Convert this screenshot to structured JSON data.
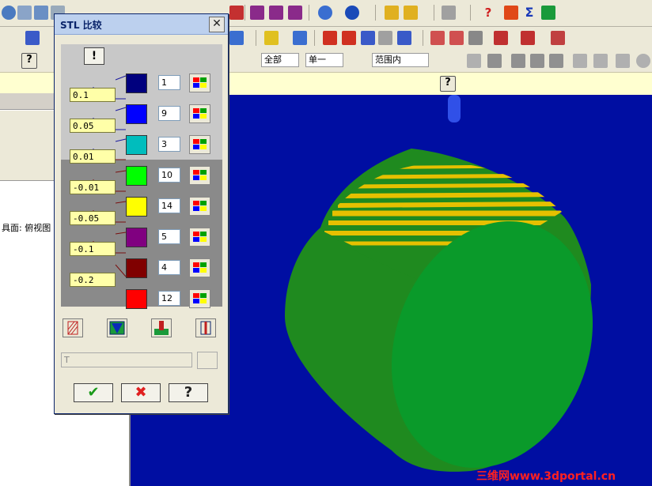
{
  "dialog": {
    "title": "STL 比较",
    "close_label": "✕",
    "help_label": "!",
    "tolerances": [
      "0.1",
      "0.05",
      "0.01",
      "-0.01",
      "-0.05",
      "-0.1",
      "-0.2"
    ],
    "colors": [
      {
        "hex": "#00007e",
        "count": "1"
      },
      {
        "hex": "#0000ff",
        "count": "9"
      },
      {
        "hex": "#00bdbd",
        "count": "3"
      },
      {
        "hex": "#00ff00",
        "count": "10"
      },
      {
        "hex": "#ffff00",
        "count": "14"
      },
      {
        "hex": "#800080",
        "count": "5"
      },
      {
        "hex": "#800000",
        "count": "4"
      },
      {
        "hex": "#ff0000",
        "count": "12"
      }
    ],
    "text_field_value": "T",
    "ok_label": "✔",
    "cancel_label": "✖",
    "help_button_label": "?"
  },
  "toolbar3": {
    "combo_all": "全部",
    "combo_single": "单一",
    "combo_range": "范围内"
  },
  "left_panel": {
    "text": "具面: 俯视图"
  },
  "watermark": "三维网www.3dportal.cn",
  "icons": [
    "help-icon",
    "close-icon",
    "palette-icon",
    "ok-check-icon",
    "cancel-x-icon",
    "question-icon"
  ]
}
